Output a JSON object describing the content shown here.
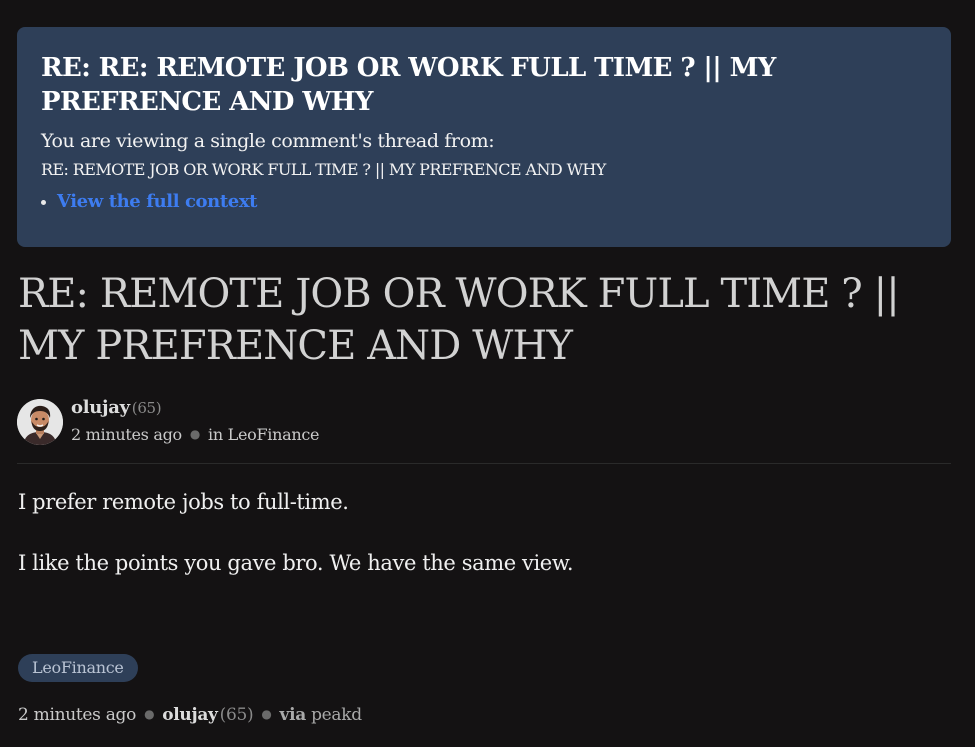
{
  "banner": {
    "title": "RE: RE: REMOTE JOB OR WORK FULL TIME ? || MY PREFRENCE AND WHY",
    "subtitle": "You are viewing a single comment's thread from:",
    "thread_title": "RE: REMOTE JOB OR WORK FULL TIME ? || MY PREFRENCE AND WHY",
    "context_link": "View the full context"
  },
  "post": {
    "title": "RE: REMOTE JOB OR WORK FULL TIME ? || MY PREFRENCE AND WHY",
    "author": {
      "name": "olujay",
      "reputation": "(65)",
      "avatar_icon": "avatar-cartoon-man-icon"
    },
    "time_ago": "2 minutes ago",
    "community": "in LeoFinance",
    "body": [
      "I prefer remote jobs to full-time.",
      "I like the points you gave bro. We have the same view."
    ],
    "tags": [
      "LeoFinance"
    ]
  },
  "footer": {
    "time_ago": "2 minutes ago",
    "author": "olujay",
    "reputation": "(65)",
    "via_label": "via",
    "app": "peakd"
  },
  "colors": {
    "background": "#141213",
    "banner": "#2e3f58",
    "link": "#3d7cf0"
  }
}
